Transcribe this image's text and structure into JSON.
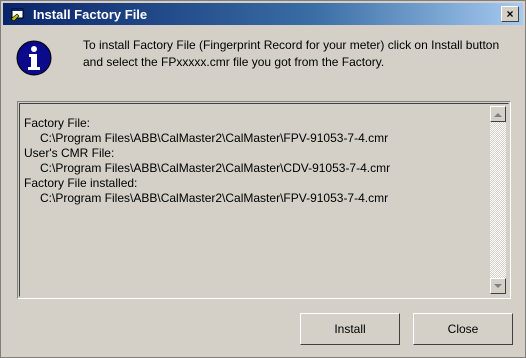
{
  "window": {
    "title": "Install Factory File",
    "close_glyph": "×"
  },
  "message": "To install Factory File (Fingerprint Record for your meter) click on Install button and select the FPxxxxx.cmr file you got from the Factory.",
  "log": {
    "lines": [
      {
        "text": "Factory File:",
        "indent": false
      },
      {
        "text": "C:\\Program Files\\ABB\\CalMaster2\\CalMaster\\FPV-91053-7-4.cmr",
        "indent": true
      },
      {
        "text": "User's CMR File:",
        "indent": false
      },
      {
        "text": "C:\\Program Files\\ABB\\CalMaster2\\CalMaster\\CDV-91053-7-4.cmr",
        "indent": true
      },
      {
        "text": "Factory File installed:",
        "indent": false
      },
      {
        "text": "C:\\Program Files\\ABB\\CalMaster2\\CalMaster\\FPV-91053-7-4.cmr",
        "indent": true
      }
    ]
  },
  "buttons": {
    "install": "Install",
    "close": "Close"
  },
  "icons": {
    "title": "app-window-icon",
    "info": "info-icon"
  }
}
